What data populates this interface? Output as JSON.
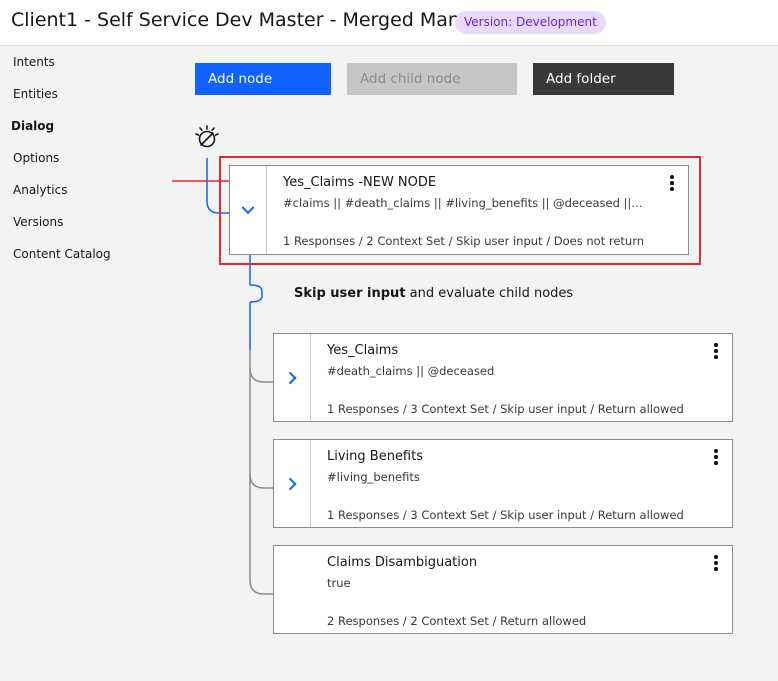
{
  "header": {
    "title": "Client1 - Self Service Dev Master - Merged Manoj",
    "version_badge": "Version: Development"
  },
  "sidebar": {
    "items": [
      {
        "label": "Intents",
        "active": false
      },
      {
        "label": "Entities",
        "active": false
      },
      {
        "label": "Dialog",
        "active": true
      },
      {
        "label": "Options",
        "active": false
      },
      {
        "label": "Analytics",
        "active": false
      },
      {
        "label": "Versions",
        "active": false
      },
      {
        "label": "Content Catalog",
        "active": false
      }
    ]
  },
  "toolbar": {
    "add_node": "Add node",
    "add_child_node": "Add child node",
    "add_folder": "Add folder"
  },
  "root_icon": "watson-icon",
  "parent_node": {
    "title": "Yes_Claims -NEW NODE",
    "condition": "#claims || #death_claims || #living_benefits || @deceased || ...",
    "summary": "1 Responses / 2 Context Set / Skip user input / Does not return",
    "expanded": true,
    "highlighted": true
  },
  "skip_message": {
    "bold": "Skip user input",
    "rest": " and evaluate child nodes"
  },
  "child_nodes": [
    {
      "title": "Yes_Claims",
      "condition": "#death_claims || @deceased",
      "summary": "1 Responses / 3 Context Set / Skip user input / Return allowed",
      "has_children": true
    },
    {
      "title": "Living Benefits",
      "condition": "#living_benefits",
      "summary": "1 Responses / 3 Context Set / Skip user input / Return allowed",
      "has_children": true
    },
    {
      "title": "Claims Disambiguation",
      "condition": "true",
      "summary": "2 Responses / 2 Context Set / Return allowed",
      "has_children": false
    }
  ],
  "colors": {
    "primary": "#0f62fe",
    "annotation_red": "#e52b2b",
    "badge_bg": "#e8daff",
    "badge_text": "#6929c4"
  }
}
